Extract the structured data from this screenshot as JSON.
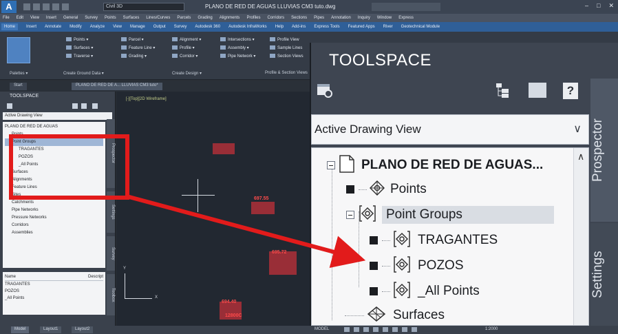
{
  "titlebar": {
    "app_logo": "A",
    "workspace": "Civil 3D",
    "document_title": "PLANO DE RED DE AGUAS LLUVIAS CM3 tuto.dwg",
    "search_placeholder": "Type a keyword or phrase",
    "sign_in": "Sign In",
    "win_min": "–",
    "win_max": "□",
    "win_close": "✕"
  },
  "menubar": [
    "File",
    "Edit",
    "View",
    "Insert",
    "General",
    "Survey",
    "Points",
    "Surfaces",
    "Lines/Curves",
    "Parcels",
    "Grading",
    "Alignments",
    "Profiles",
    "Corridors",
    "Sections",
    "Pipes",
    "Annotation",
    "Inquiry",
    "Window",
    "Express"
  ],
  "ribbon_tabs": [
    "Home",
    "Insert",
    "Annotate",
    "Modify",
    "Analyze",
    "View",
    "Manage",
    "Output",
    "Survey",
    "Autodesk 360",
    "Autodesk InfraWorks",
    "Help",
    "Add-ins",
    "Express Tools",
    "Featured Apps",
    "River",
    "Geotechnical Module"
  ],
  "ribbon": {
    "col1": [
      "Points ▾",
      "Surfaces ▾",
      "Traverse ▾"
    ],
    "col2": [
      "Parcel ▾",
      "Feature Line ▾",
      "Grading ▾"
    ],
    "col3": [
      "Alignment ▾",
      "Profile ▾",
      "Corridor ▾"
    ],
    "col4": [
      "Intersections ▾",
      "Assembly ▾",
      "Pipe Network ▾"
    ],
    "col5": [
      "Profile View",
      "Sample Lines",
      "Section Views"
    ],
    "panel_palettes": "Palettes ▾",
    "panel_ground": "Create Ground Data ▾",
    "panel_design": "Create Design ▾",
    "panel_profile": "Profile & Section Views"
  },
  "doc_tabs": [
    "Start",
    "PLANO DE RED DE A... LLUVIAS CM3 tuto*"
  ],
  "small_toolspace": {
    "title": "TOOLSPACE",
    "view_select": "Active Drawing View",
    "tree": [
      "PLANO DE RED DE AGUAS",
      "Points",
      "Point Groups",
      "TRAGANTES",
      "POZOS",
      "_All Points",
      "Surfaces",
      "Alignments",
      "Feature Lines",
      "Sites",
      "Catchments",
      "Pipe Networks",
      "Pressure Networks",
      "Corridors",
      "Assemblies"
    ],
    "list_header_name": "Name",
    "list_header_desc": "Descript",
    "list_items": [
      "TRAGANTES",
      "POZOS",
      "_All Points"
    ],
    "vtabs": [
      "Prospector",
      "Settings",
      "Survey",
      "Toolbox"
    ]
  },
  "canvas": {
    "viewport_label": "[-][Top][2D Wireframe]",
    "labels": [
      "697.55",
      "695.72",
      "694.40",
      "12800C"
    ],
    "ucs_y": "Y",
    "ucs_x": "X"
  },
  "statusbar": {
    "tabs": [
      "Model",
      "Layout1",
      "Layout2"
    ],
    "model_label": "MODEL",
    "scale": "1:2000"
  },
  "zoom_toolspace": {
    "title": "TOOLSPACE",
    "view_select": "Active Drawing View",
    "tree": {
      "root": "PLANO DE RED DE AGUAS...",
      "points": "Points",
      "point_groups": "Point Groups",
      "group1": "TRAGANTES",
      "group2": "POZOS",
      "group3": "_All Points",
      "surfaces": "Surfaces"
    },
    "tab_prospector": "Prospector",
    "tab_settings": "Settings"
  },
  "icons": {
    "settings": "toolspace-settings-icon",
    "tree_view": "tree-view-icon",
    "item_view": "item-view-icon",
    "help": "?",
    "dropdown": "chevron-down-icon",
    "scroll_up": "scroll-up-icon",
    "point": "point-icon",
    "point_group": "point-group-icon",
    "surface": "surface-icon",
    "drawing": "drawing-icon"
  },
  "colors": {
    "annotation_red": "#e21b1b",
    "point_label_red": "#ff4b4b",
    "canvas_bg": "#222831",
    "ribbon_blue": "#2f5f98"
  }
}
